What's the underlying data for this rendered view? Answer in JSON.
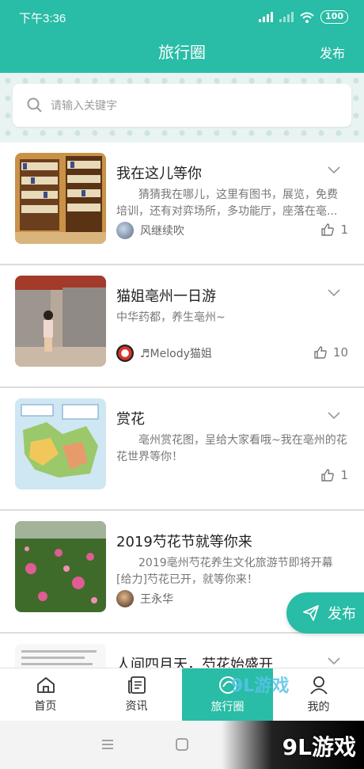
{
  "status": {
    "time": "下午3:36",
    "battery": "100"
  },
  "header": {
    "title": "旅行圈",
    "publish_label": "发布"
  },
  "search": {
    "placeholder": "请输入关键字"
  },
  "posts": [
    {
      "title": "我在这儿等你",
      "desc": "猜猜我在哪儿，这里有图书，展览，免费培训，还有对弈场所，多功能厅，座落在亳...",
      "author": "风继续吹",
      "likes": "1"
    },
    {
      "title": "猫姐亳州一日游",
      "desc": "中华药都，养生亳州~",
      "author": "♬Melody猫姐",
      "likes": "10"
    },
    {
      "title": "赏花",
      "desc": "亳州赏花图，呈给大家看哦~我在亳州的花花世界等你！",
      "author": "",
      "likes": "1"
    },
    {
      "title": "2019芍花节就等你来",
      "desc": "2019亳州芍花养生文化旅游节即将开幕[给力]芍花已开，就等你来！",
      "author": "王永华",
      "likes": ""
    },
    {
      "title": "人间四月天，芍花始盛开",
      "desc": "",
      "author": "",
      "likes": ""
    }
  ],
  "fab": {
    "label": "发布"
  },
  "tabs": [
    {
      "label": "首页",
      "icon": "home-icon"
    },
    {
      "label": "资讯",
      "icon": "news-icon"
    },
    {
      "label": "旅行圈",
      "icon": "circle-icon"
    },
    {
      "label": "我的",
      "icon": "user-icon"
    }
  ],
  "watermark": {
    "main": "9L游戏",
    "small": "9L游戏"
  },
  "colors": {
    "accent": "#29bca6"
  }
}
